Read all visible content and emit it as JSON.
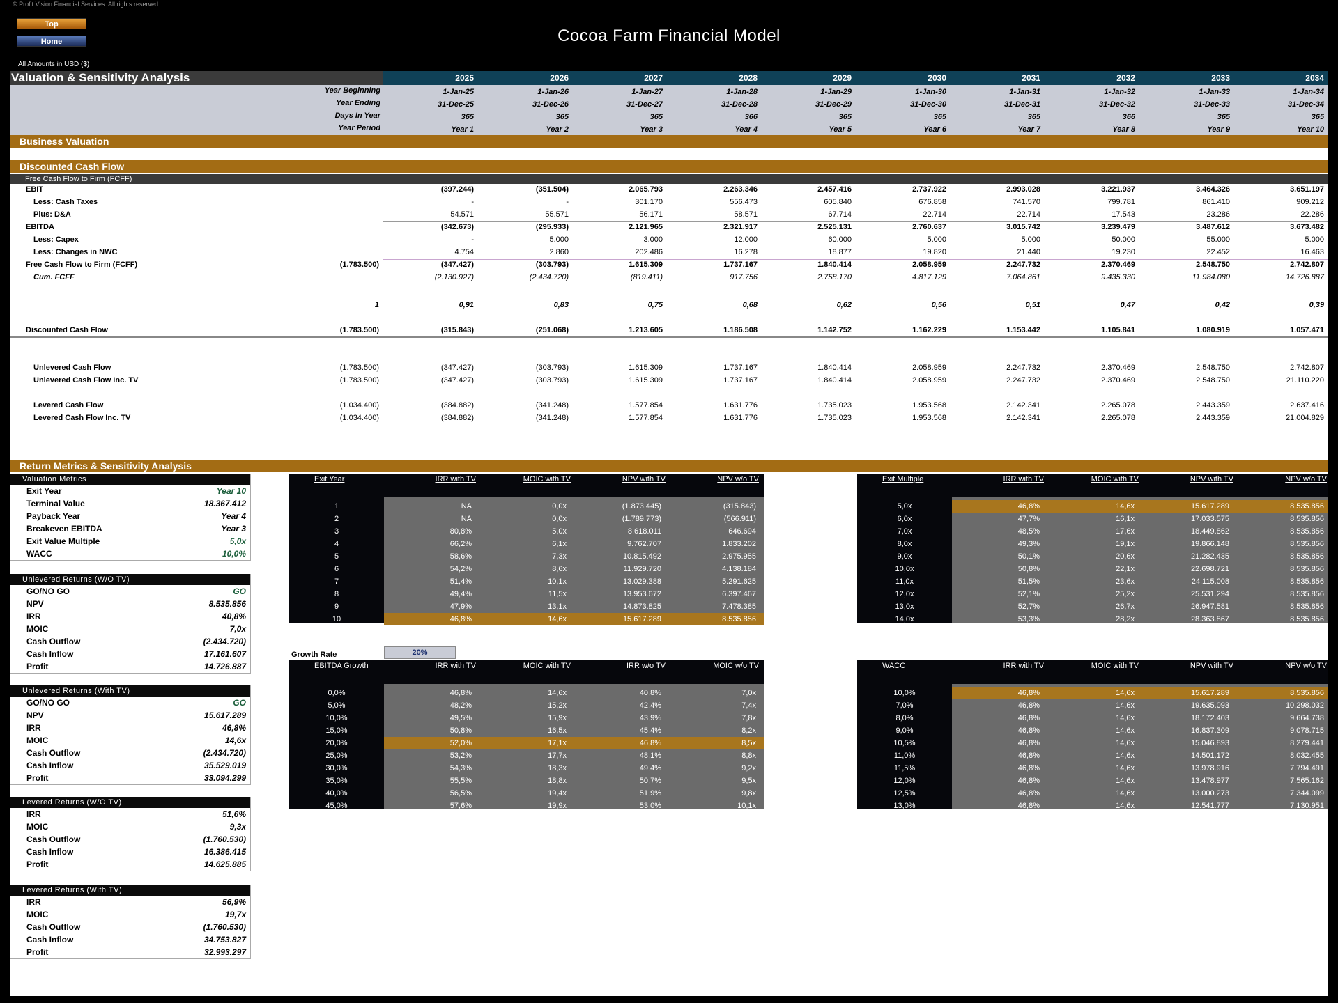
{
  "copyright": "© Profit Vision Financial Services. All rights reserved.",
  "nav": {
    "top_label": "Top",
    "home_label": "Home"
  },
  "app_title": "Cocoa Farm Financial Model",
  "amounts_note": "All Amounts in  USD ($)",
  "header": {
    "title": "Valuation & Sensitivity Analysis",
    "years": [
      "2025",
      "2026",
      "2027",
      "2028",
      "2029",
      "2030",
      "2031",
      "2032",
      "2033",
      "2034"
    ],
    "timeline_labels": [
      "Year Beginning",
      "Year Ending",
      "Days In Year",
      "Year Period"
    ],
    "year_beginning": [
      "1-Jan-25",
      "1-Jan-26",
      "1-Jan-27",
      "1-Jan-28",
      "1-Jan-29",
      "1-Jan-30",
      "1-Jan-31",
      "1-Jan-32",
      "1-Jan-33",
      "1-Jan-34"
    ],
    "year_ending": [
      "31-Dec-25",
      "31-Dec-26",
      "31-Dec-27",
      "31-Dec-28",
      "31-Dec-29",
      "31-Dec-30",
      "31-Dec-31",
      "31-Dec-32",
      "31-Dec-33",
      "31-Dec-34"
    ],
    "days_in_year": [
      "365",
      "365",
      "365",
      "366",
      "365",
      "365",
      "365",
      "366",
      "365",
      "365"
    ],
    "year_period": [
      "Year 1",
      "Year 2",
      "Year 3",
      "Year 4",
      "Year 5",
      "Year 6",
      "Year 7",
      "Year 8",
      "Year 9",
      "Year 10"
    ]
  },
  "sections": {
    "business_valuation": "Business Valuation",
    "dcf": "Discounted Cash Flow",
    "fcff_sub": "Free Cash Flow to Firm (FCFF)",
    "return_metrics": "Return Metrics & Sensitivity Analysis"
  },
  "dcf_rows": [
    {
      "label": "EBIT",
      "style": "b",
      "indent": 0,
      "initial": "",
      "values": [
        "(397.244)",
        "(351.504)",
        "2.065.793",
        "2.263.346",
        "2.457.416",
        "2.737.922",
        "2.993.028",
        "3.221.937",
        "3.464.326",
        "3.651.197"
      ]
    },
    {
      "label": "Less: Cash Taxes",
      "style": "b",
      "indent": 1,
      "initial": "",
      "values": [
        "-",
        "-",
        "301.170",
        "556.473",
        "605.840",
        "676.858",
        "741.570",
        "799.781",
        "861.410",
        "909.212"
      ]
    },
    {
      "label": "Plus: D&A",
      "style": "b",
      "indent": 1,
      "initial": "",
      "values": [
        "54.571",
        "55.571",
        "56.171",
        "58.571",
        "67.714",
        "22.714",
        "22.714",
        "17.543",
        "23.286",
        "22.286"
      ]
    },
    {
      "label": "EBITDA",
      "style": "b",
      "indent": 0,
      "initial": "",
      "values": [
        "(342.673)",
        "(295.933)",
        "2.121.965",
        "2.321.917",
        "2.525.131",
        "2.760.637",
        "3.015.742",
        "3.239.479",
        "3.487.612",
        "3.673.482"
      ]
    },
    {
      "label": "Less: Capex",
      "style": "b",
      "indent": 1,
      "initial": "",
      "values": [
        "-",
        "5.000",
        "3.000",
        "12.000",
        "60.000",
        "5.000",
        "5.000",
        "50.000",
        "55.000",
        "5.000"
      ]
    },
    {
      "label": "Less: Changes in NWC",
      "style": "b",
      "indent": 1,
      "initial": "",
      "values": [
        "4.754",
        "2.860",
        "202.486",
        "16.278",
        "18.877",
        "19.820",
        "21.440",
        "19.230",
        "22.452",
        "16.463"
      ]
    },
    {
      "label": "Free Cash Flow to Firm (FCFF)",
      "style": "b",
      "indent": 0,
      "initial": "(1.783.500)",
      "values": [
        "(347.427)",
        "(303.793)",
        "1.615.309",
        "1.737.167",
        "1.840.414",
        "2.058.959",
        "2.247.732",
        "2.370.469",
        "2.548.750",
        "2.742.807"
      ]
    },
    {
      "label": "Cum. FCFF",
      "style": "i",
      "indent": 1,
      "initial": "",
      "values": [
        "(2.130.927)",
        "(2.434.720)",
        "(819.411)",
        "917.756",
        "2.758.170",
        "4.817.129",
        "7.064.861",
        "9.435.330",
        "11.984.080",
        "14.726.887"
      ]
    }
  ],
  "discount_factor": {
    "initial": "1",
    "values": [
      "0,91",
      "0,83",
      "0,75",
      "0,68",
      "0,62",
      "0,56",
      "0,51",
      "0,47",
      "0,42",
      "0,39"
    ]
  },
  "discounted_cf": {
    "label": "Discounted Cash Flow",
    "initial": "(1.783.500)",
    "values": [
      "(315.843)",
      "(251.068)",
      "1.213.605",
      "1.186.508",
      "1.142.752",
      "1.162.229",
      "1.153.442",
      "1.105.841",
      "1.080.919",
      "1.057.471"
    ]
  },
  "cash_flows": [
    {
      "label": "Unlevered Cash Flow",
      "initial": "(1.783.500)",
      "values": [
        "(347.427)",
        "(303.793)",
        "1.615.309",
        "1.737.167",
        "1.840.414",
        "2.058.959",
        "2.247.732",
        "2.370.469",
        "2.548.750",
        "2.742.807"
      ]
    },
    {
      "label": "Unlevered Cash Flow Inc. TV",
      "initial": "(1.783.500)",
      "values": [
        "(347.427)",
        "(303.793)",
        "1.615.309",
        "1.737.167",
        "1.840.414",
        "2.058.959",
        "2.247.732",
        "2.370.469",
        "2.548.750",
        "21.110.220"
      ]
    },
    {
      "label": "Levered Cash Flow",
      "initial": "(1.034.400)",
      "values": [
        "(384.882)",
        "(341.248)",
        "1.577.854",
        "1.631.776",
        "1.735.023",
        "1.953.568",
        "2.142.341",
        "2.265.078",
        "2.443.359",
        "2.637.416"
      ]
    },
    {
      "label": "Levered Cash Flow Inc. TV",
      "initial": "(1.034.400)",
      "values": [
        "(384.882)",
        "(341.248)",
        "1.577.854",
        "1.631.776",
        "1.735.023",
        "1.953.568",
        "2.142.341",
        "2.265.078",
        "2.443.359",
        "21.004.829"
      ]
    }
  ],
  "side_boxes": [
    {
      "title": "Valuation Metrics",
      "rows": [
        {
          "label": "Exit Year",
          "value": "Year 10",
          "green": true
        },
        {
          "label": "Terminal Value",
          "value": "18.367.412",
          "green": false
        },
        {
          "label": "Payback Year",
          "value": "Year 4",
          "green": false
        },
        {
          "label": "Breakeven EBITDA",
          "value": "Year 3",
          "green": false
        },
        {
          "label": "Exit Value Multiple",
          "value": "5,0x",
          "green": true
        },
        {
          "label": "WACC",
          "value": "10,0%",
          "green": true
        }
      ]
    },
    {
      "title": "Unlevered Returns (W/O TV)",
      "rows": [
        {
          "label": "GO/NO GO",
          "value": "GO",
          "green": true
        },
        {
          "label": "NPV",
          "value": "8.535.856",
          "green": false
        },
        {
          "label": "IRR",
          "value": "40,8%",
          "green": false
        },
        {
          "label": "MOIC",
          "value": "7,0x",
          "green": false
        },
        {
          "label": "Cash Outflow",
          "value": "(2.434.720)",
          "green": false
        },
        {
          "label": "Cash Inflow",
          "value": "17.161.607",
          "green": false
        },
        {
          "label": "Profit",
          "value": "14.726.887",
          "green": false
        }
      ]
    },
    {
      "title": "Unlevered Returns (With TV)",
      "rows": [
        {
          "label": "GO/NO GO",
          "value": "GO",
          "green": true
        },
        {
          "label": "NPV",
          "value": "15.617.289",
          "green": false
        },
        {
          "label": "IRR",
          "value": "46,8%",
          "green": false
        },
        {
          "label": "MOIC",
          "value": "14,6x",
          "green": false
        },
        {
          "label": "Cash Outflow",
          "value": "(2.434.720)",
          "green": false
        },
        {
          "label": "Cash Inflow",
          "value": "35.529.019",
          "green": false
        },
        {
          "label": "Profit",
          "value": "33.094.299",
          "green": false
        }
      ]
    },
    {
      "title": "Levered Returns (W/O TV)",
      "rows": [
        {
          "label": "IRR",
          "value": "51,6%",
          "green": false
        },
        {
          "label": "MOIC",
          "value": "9,3x",
          "green": false
        },
        {
          "label": "Cash Outflow",
          "value": "(1.760.530)",
          "green": false
        },
        {
          "label": "Cash Inflow",
          "value": "16.386.415",
          "green": false
        },
        {
          "label": "Profit",
          "value": "14.625.885",
          "green": false
        }
      ]
    },
    {
      "title": "Levered Returns (With TV)",
      "rows": [
        {
          "label": "IRR",
          "value": "56,9%",
          "green": false
        },
        {
          "label": "MOIC",
          "value": "19,7x",
          "green": false
        },
        {
          "label": "Cash Outflow",
          "value": "(1.760.530)",
          "green": false
        },
        {
          "label": "Cash Inflow",
          "value": "34.753.827",
          "green": false
        },
        {
          "label": "Profit",
          "value": "32.993.297",
          "green": false
        }
      ]
    }
  ],
  "growth_rate": {
    "label": "Growth Rate",
    "value": "20%"
  },
  "sensitivity_tables": [
    {
      "id": "exit-year",
      "headers": [
        "Exit Year",
        "IRR with TV",
        "MOIC with TV",
        "NPV with TV",
        "NPV w/o TV"
      ],
      "highlight": 9,
      "rows": [
        [
          "1",
          "NA",
          "0,0x",
          "(1.873.445)",
          "(315.843)"
        ],
        [
          "2",
          "NA",
          "0,0x",
          "(1.789.773)",
          "(566.911)"
        ],
        [
          "3",
          "80,8%",
          "5,0x",
          "8.618.011",
          "646.694"
        ],
        [
          "4",
          "66,2%",
          "6,1x",
          "9.762.707",
          "1.833.202"
        ],
        [
          "5",
          "58,6%",
          "7,3x",
          "10.815.492",
          "2.975.955"
        ],
        [
          "6",
          "54,2%",
          "8,6x",
          "11.929.720",
          "4.138.184"
        ],
        [
          "7",
          "51,4%",
          "10,1x",
          "13.029.388",
          "5.291.625"
        ],
        [
          "8",
          "49,4%",
          "11,5x",
          "13.953.672",
          "6.397.467"
        ],
        [
          "9",
          "47,9%",
          "13,1x",
          "14.873.825",
          "7.478.385"
        ],
        [
          "10",
          "46,8%",
          "14,6x",
          "15.617.289",
          "8.535.856"
        ]
      ]
    },
    {
      "id": "exit-multiple",
      "headers": [
        "Exit Multiple",
        "IRR with TV",
        "MOIC with TV",
        "NPV with TV",
        "NPV w/o TV"
      ],
      "highlight": 0,
      "rows": [
        [
          "5,0x",
          "46,8%",
          "14,6x",
          "15.617.289",
          "8.535.856"
        ],
        [
          "6,0x",
          "47,7%",
          "16,1x",
          "17.033.575",
          "8.535.856"
        ],
        [
          "7,0x",
          "48,5%",
          "17,6x",
          "18.449.862",
          "8.535.856"
        ],
        [
          "8,0x",
          "49,3%",
          "19,1x",
          "19.866.148",
          "8.535.856"
        ],
        [
          "9,0x",
          "50,1%",
          "20,6x",
          "21.282.435",
          "8.535.856"
        ],
        [
          "10,0x",
          "50,8%",
          "22,1x",
          "22.698.721",
          "8.535.856"
        ],
        [
          "11,0x",
          "51,5%",
          "23,6x",
          "24.115.008",
          "8.535.856"
        ],
        [
          "12,0x",
          "52,1%",
          "25,2x",
          "25.531.294",
          "8.535.856"
        ],
        [
          "13,0x",
          "52,7%",
          "26,7x",
          "26.947.581",
          "8.535.856"
        ],
        [
          "14,0x",
          "53,3%",
          "28,2x",
          "28.363.867",
          "8.535.856"
        ]
      ]
    },
    {
      "id": "ebitda-growth",
      "headers": [
        "EBITDA Growth",
        "IRR with TV",
        "MOIC with TV",
        "IRR w/o TV",
        "MOIC w/o TV"
      ],
      "highlight": 4,
      "rows": [
        [
          "0,0%",
          "46,8%",
          "14,6x",
          "40,8%",
          "7,0x"
        ],
        [
          "5,0%",
          "48,2%",
          "15,2x",
          "42,4%",
          "7,4x"
        ],
        [
          "10,0%",
          "49,5%",
          "15,9x",
          "43,9%",
          "7,8x"
        ],
        [
          "15,0%",
          "50,8%",
          "16,5x",
          "45,4%",
          "8,2x"
        ],
        [
          "20,0%",
          "52,0%",
          "17,1x",
          "46,8%",
          "8,5x"
        ],
        [
          "25,0%",
          "53,2%",
          "17,7x",
          "48,1%",
          "8,8x"
        ],
        [
          "30,0%",
          "54,3%",
          "18,3x",
          "49,4%",
          "9,2x"
        ],
        [
          "35,0%",
          "55,5%",
          "18,8x",
          "50,7%",
          "9,5x"
        ],
        [
          "40,0%",
          "56,5%",
          "19,4x",
          "51,9%",
          "9,8x"
        ],
        [
          "45,0%",
          "57,6%",
          "19,9x",
          "53,0%",
          "10,1x"
        ]
      ]
    },
    {
      "id": "wacc",
      "headers": [
        "WACC",
        "IRR with TV",
        "MOIC with TV",
        "NPV with TV",
        "NPV w/o TV"
      ],
      "highlight": 0,
      "rows": [
        [
          "10,0%",
          "46,8%",
          "14,6x",
          "15.617.289",
          "8.535.856"
        ],
        [
          "7,0%",
          "46,8%",
          "14,6x",
          "19.635.093",
          "10.298.032"
        ],
        [
          "8,0%",
          "46,8%",
          "14,6x",
          "18.172.403",
          "9.664.738"
        ],
        [
          "9,0%",
          "46,8%",
          "14,6x",
          "16.837.309",
          "9.078.715"
        ],
        [
          "10,5%",
          "46,8%",
          "14,6x",
          "15.046.893",
          "8.279.441"
        ],
        [
          "11,0%",
          "46,8%",
          "14,6x",
          "14.501.172",
          "8.032.455"
        ],
        [
          "11,5%",
          "46,8%",
          "14,6x",
          "13.978.916",
          "7.794.491"
        ],
        [
          "12,0%",
          "46,8%",
          "14,6x",
          "13.478.977",
          "7.565.162"
        ],
        [
          "12,5%",
          "46,8%",
          "14,6x",
          "13.000.273",
          "7.344.099"
        ],
        [
          "13,0%",
          "46,8%",
          "14,6x",
          "12.541.777",
          "7.130.951"
        ]
      ]
    }
  ]
}
